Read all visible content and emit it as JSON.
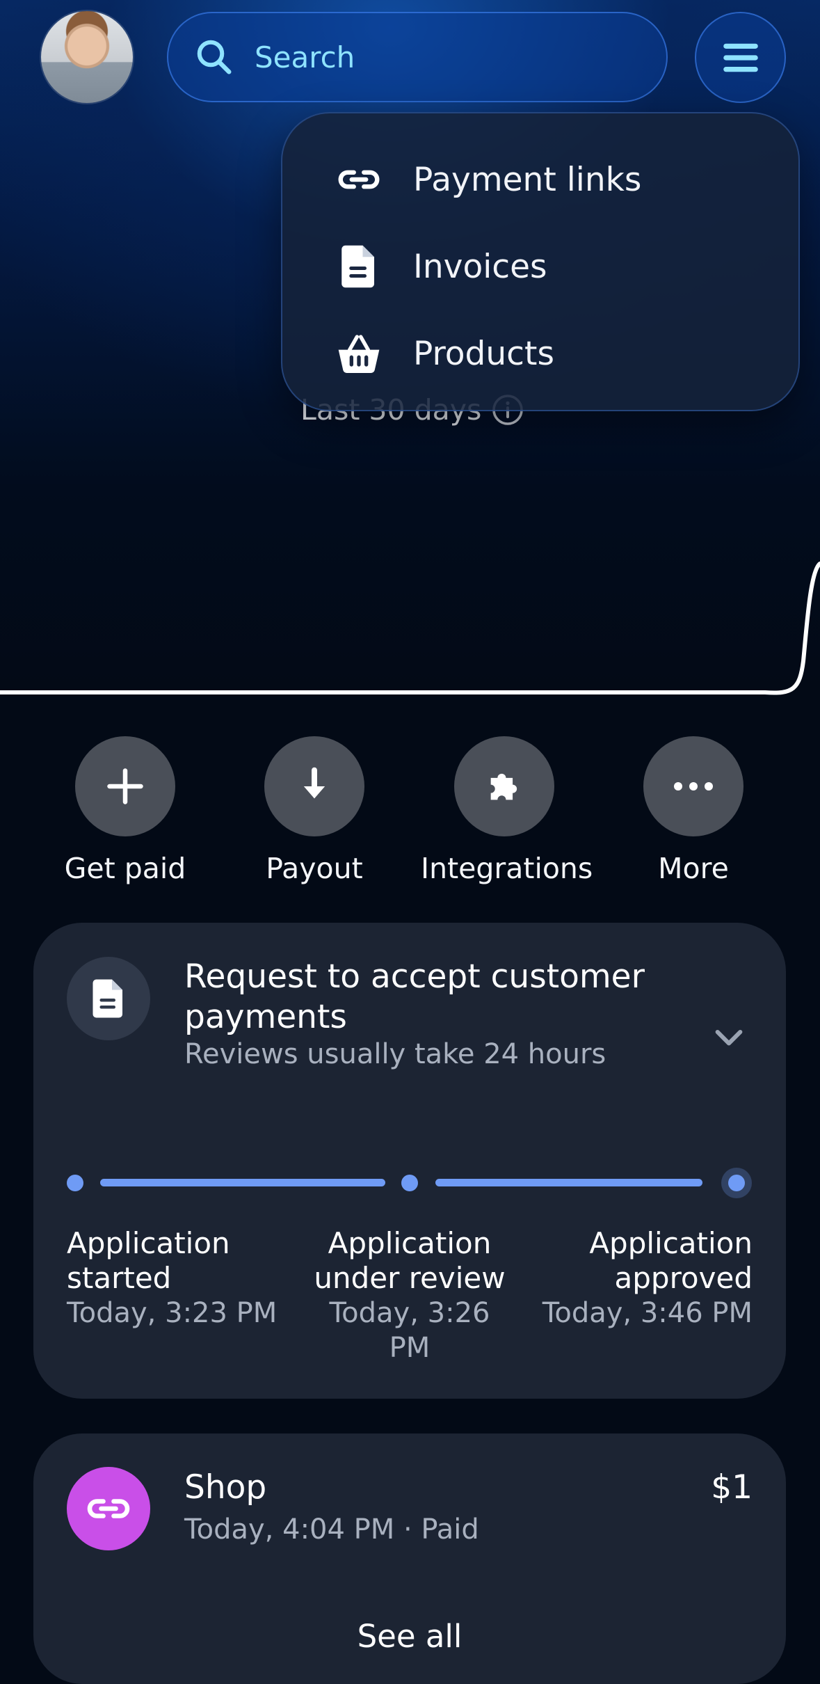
{
  "header": {
    "search_placeholder": "Search"
  },
  "dropdown": {
    "items": [
      {
        "label": "Payment links",
        "icon": "link-icon"
      },
      {
        "label": "Invoices",
        "icon": "document-icon"
      },
      {
        "label": "Products",
        "icon": "basket-icon"
      }
    ]
  },
  "summary": {
    "period": "Last 30 days"
  },
  "actions": [
    {
      "label": "Get paid",
      "icon": "plus-icon"
    },
    {
      "label": "Payout",
      "icon": "download-arrow-icon"
    },
    {
      "label": "Integrations",
      "icon": "puzzle-icon"
    },
    {
      "label": "More",
      "icon": "more-dots-icon"
    }
  ],
  "request_card": {
    "title": "Request to accept customer payments",
    "subtitle": "Reviews usually take 24 hours",
    "steps": [
      {
        "title": "Application started",
        "time": "Today, 3:23 PM"
      },
      {
        "title": "Application under review",
        "time": "Today, 3:26 PM"
      },
      {
        "title": "Application approved",
        "time": "Today, 3:46 PM"
      }
    ]
  },
  "activity": {
    "items": [
      {
        "title": "Shop",
        "subtitle": "Today, 4:04 PM · Paid",
        "amount": "$1"
      }
    ],
    "see_all": "See all"
  },
  "colors": {
    "accent": "#6f9bf5",
    "search_text": "#8fe3ff",
    "card_bg": "#1c2433",
    "shop_icon_bg": "#c94fe8"
  }
}
